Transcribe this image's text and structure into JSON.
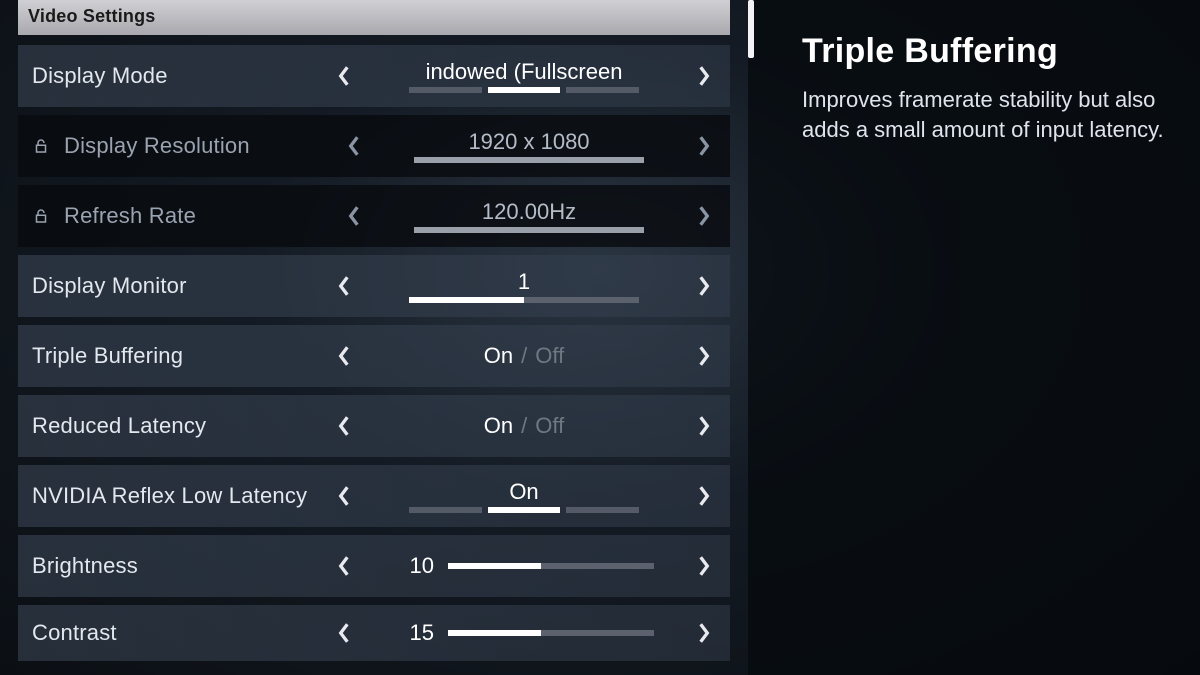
{
  "header": {
    "title": "Video Settings"
  },
  "rows": {
    "display_mode": {
      "label": "Display Mode",
      "value": "indowed (Fullscreen",
      "segments": 3,
      "active_segment": 1,
      "locked": false
    },
    "display_resolution": {
      "label": "Display Resolution",
      "value": "1920 x 1080",
      "locked": true
    },
    "refresh_rate": {
      "label": "Refresh Rate",
      "value": "120.00Hz",
      "locked": true
    },
    "display_monitor": {
      "label": "Display Monitor",
      "value": "1",
      "binary_on_left": true,
      "locked": false
    },
    "triple_buffering": {
      "label": "Triple Buffering",
      "on": "On",
      "off": "Off",
      "active": "on",
      "locked": false
    },
    "reduced_latency": {
      "label": "Reduced Latency",
      "on": "On",
      "off": "Off",
      "active": "on",
      "locked": false
    },
    "nvidia_reflex": {
      "label": "NVIDIA Reflex Low Latency",
      "value": "On",
      "segments": 3,
      "active_segment": 1,
      "locked": false
    },
    "brightness": {
      "label": "Brightness",
      "value": "10",
      "percent": 45,
      "locked": false
    },
    "contrast": {
      "label": "Contrast",
      "value": "15",
      "percent": 45,
      "locked": false
    }
  },
  "info": {
    "title": "Triple Buffering",
    "description": "Improves framerate stability but also adds a small amount of input latency."
  }
}
